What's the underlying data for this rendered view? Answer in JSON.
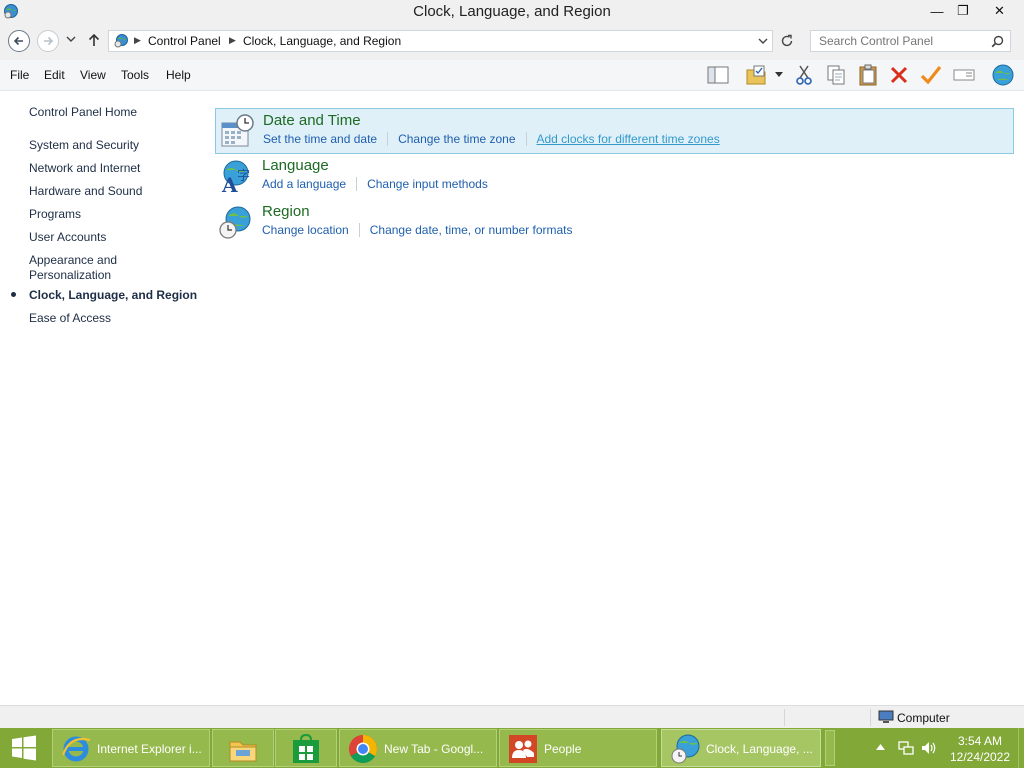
{
  "window": {
    "title": "Clock, Language, and Region",
    "min_glyph": "—",
    "max_glyph": "❐",
    "close_glyph": "✕"
  },
  "address": {
    "crumbs": [
      "Control Panel",
      "Clock, Language, and Region"
    ],
    "search_placeholder": "Search Control Panel"
  },
  "menu": [
    "File",
    "Edit",
    "View",
    "Tools",
    "Help"
  ],
  "toolbar_icons": [
    "layout-pane-icon",
    "folder-options-icon",
    "dropdown-arrow-icon",
    "cut-icon",
    "copy-icon",
    "paste-icon",
    "delete-icon",
    "properties-check-icon",
    "rename-icon",
    "globe-icon"
  ],
  "leftnav": {
    "home": "Control Panel Home",
    "items": [
      "System and Security",
      "Network and Internet",
      "Hardware and Sound",
      "Programs",
      "User Accounts",
      "Appearance and Personalization",
      "Clock, Language, and Region",
      "Ease of Access"
    ],
    "current_index": 6
  },
  "categories": [
    {
      "title": "Date and Time",
      "icon": "date-time-icon",
      "links": [
        "Set the time and date",
        "Change the time zone",
        "Add clocks for different time zones"
      ]
    },
    {
      "title": "Language",
      "icon": "language-icon",
      "links": [
        "Add a language",
        "Change input methods"
      ]
    },
    {
      "title": "Region",
      "icon": "region-globe-icon",
      "links": [
        "Change location",
        "Change date, time, or number formats"
      ]
    }
  ],
  "statusbar": {
    "location_label": "Computer"
  },
  "taskbar": {
    "buttons": [
      {
        "label": "Internet Explorer i...",
        "icon": "internet-explorer-icon"
      },
      {
        "label": "",
        "icon": "file-explorer-icon"
      },
      {
        "label": "",
        "icon": "store-icon"
      },
      {
        "label": "New Tab - Googl...",
        "icon": "chrome-icon"
      },
      {
        "label": "People",
        "icon": "people-icon"
      },
      {
        "label": "Clock, Language, ...",
        "icon": "control-panel-icon"
      }
    ],
    "time": "3:54 AM",
    "date": "12/24/2022"
  },
  "colors": {
    "taskbar": "#82a838",
    "link": "#1f5fae",
    "category_title": "#1d6a23",
    "selection_bg": "#dff0f8"
  }
}
